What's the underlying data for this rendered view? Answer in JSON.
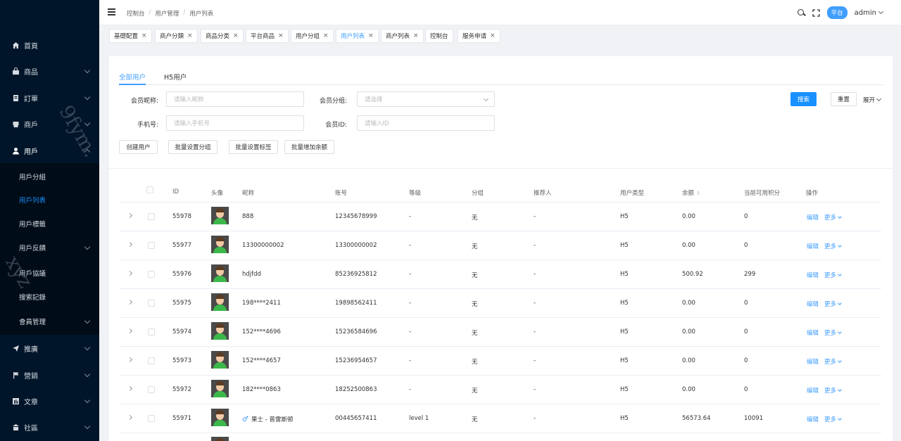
{
  "sidebar": {
    "menu": [
      {
        "label": "首頁",
        "icon": "home-icon",
        "has_children": false
      },
      {
        "label": "商品",
        "icon": "bag-icon",
        "has_children": true
      },
      {
        "label": "訂單",
        "icon": "clipboard-icon",
        "has_children": true
      },
      {
        "label": "商戶",
        "icon": "store-icon",
        "has_children": true
      },
      {
        "label": "用戶",
        "icon": "user-icon",
        "has_children": true
      }
    ],
    "submenu": [
      {
        "label": "用戶分組",
        "has_children": false
      },
      {
        "label": "用戶列表",
        "has_children": false,
        "active": true
      },
      {
        "label": "用戶標籤",
        "has_children": false
      },
      {
        "label": "用戶反饋",
        "has_children": true
      },
      {
        "label": "用戶協議",
        "has_children": false
      },
      {
        "label": "搜索記錄",
        "has_children": false
      },
      {
        "label": "會員管理",
        "has_children": true
      }
    ],
    "menu_bottom": [
      {
        "label": "推廣",
        "icon": "send-icon",
        "has_children": true
      },
      {
        "label": "營銷",
        "icon": "flag-icon",
        "has_children": true
      },
      {
        "label": "文章",
        "icon": "bar-chart-icon",
        "has_children": true
      },
      {
        "label": "社區",
        "icon": "community-icon",
        "has_children": true
      }
    ],
    "watermark": "9fym.",
    "watermark2": "xyz"
  },
  "header": {
    "breadcrumb": [
      "控制台",
      "用户管理",
      "用户列表"
    ],
    "platform_badge": "平台",
    "user": "admin"
  },
  "tags": [
    {
      "label": "基礎配置",
      "closable": true
    },
    {
      "label": "商户分類",
      "closable": true
    },
    {
      "label": "商品分类",
      "closable": true
    },
    {
      "label": "平台商品",
      "closable": true
    },
    {
      "label": "用户分组",
      "closable": true
    },
    {
      "label": "用户列表",
      "closable": true,
      "active": true
    },
    {
      "label": "商户列表",
      "closable": true
    },
    {
      "label": "控制台",
      "closable": false
    },
    {
      "label": "服务申请",
      "closable": true
    }
  ],
  "tabs": [
    "全部用户",
    "H5用户"
  ],
  "filters": {
    "nickname_label": "会员昵称:",
    "nickname_placeholder": "请输入昵称",
    "group_label": "会员分组:",
    "group_placeholder": "请选择",
    "phone_label": "手机号:",
    "phone_placeholder": "请输入手机号",
    "id_label": "会员ID:",
    "id_placeholder": "请输入ID",
    "search_button": "搜索",
    "reset_button": "重置",
    "expand_label": "展开"
  },
  "actions": [
    "创建用户",
    "批量设置分组",
    "批量设置标签",
    "批量增加余额"
  ],
  "table": {
    "columns": [
      "ID",
      "头像",
      "昵称",
      "账号",
      "等级",
      "分组",
      "推荐人",
      "用户类型",
      "余额",
      "当前可用积分",
      "操作"
    ],
    "edit_label": "编辑",
    "more_label": "更多",
    "rows": [
      {
        "id": "55978",
        "nickname": "888",
        "account": "12345678999",
        "level": "-",
        "group": "无",
        "referrer": "-",
        "type": "H5",
        "balance": "0.00",
        "points": "0"
      },
      {
        "id": "55977",
        "nickname": "13300000002",
        "account": "13300000002",
        "level": "-",
        "group": "无",
        "referrer": "-",
        "type": "H5",
        "balance": "0.00",
        "points": "0"
      },
      {
        "id": "55976",
        "nickname": "hdjfdd",
        "account": "85236925812",
        "level": "-",
        "group": "无",
        "referrer": "-",
        "type": "H5",
        "balance": "500.92",
        "points": "299"
      },
      {
        "id": "55975",
        "nickname": "198****2411",
        "account": "19898562411",
        "level": "-",
        "group": "无",
        "referrer": "-",
        "type": "H5",
        "balance": "0.00",
        "points": "0"
      },
      {
        "id": "55974",
        "nickname": "152****4696",
        "account": "15236584696",
        "level": "-",
        "group": "无",
        "referrer": "-",
        "type": "H5",
        "balance": "0.00",
        "points": "0"
      },
      {
        "id": "55973",
        "nickname": "152****4657",
        "account": "15236954657",
        "level": "-",
        "group": "无",
        "referrer": "-",
        "type": "H5",
        "balance": "0.00",
        "points": "0"
      },
      {
        "id": "55972",
        "nickname": "182****0863",
        "account": "18252500863",
        "level": "-",
        "group": "无",
        "referrer": "-",
        "type": "H5",
        "balance": "0.00",
        "points": "0"
      },
      {
        "id": "55971",
        "nickname": "果士 - 普雷斯顿",
        "account": "00445657411",
        "level": "level 1",
        "group": "无",
        "referrer": "-",
        "type": "H5",
        "balance": "56573.64",
        "points": "10091",
        "male": true
      }
    ]
  }
}
